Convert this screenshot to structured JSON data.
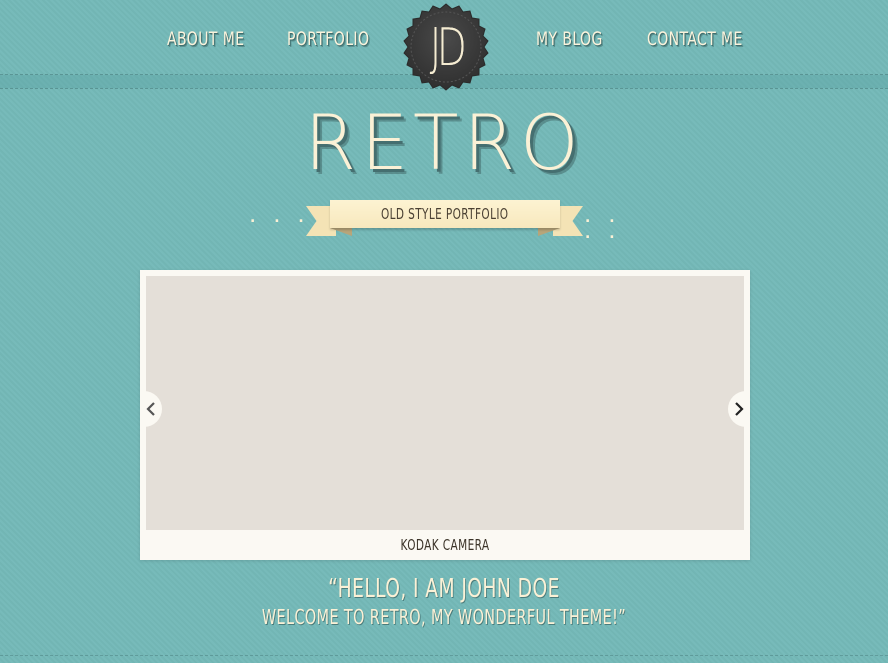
{
  "nav": {
    "items": [
      {
        "label": "About Me"
      },
      {
        "label": "Portfolio"
      },
      {
        "label": "My Blog"
      },
      {
        "label": "Contact Me"
      }
    ]
  },
  "logo": {
    "text": "JD"
  },
  "hero": {
    "title": "RETRO",
    "ribbon_text": "Old Style Portfolio",
    "ribbon_dots": ". . . ."
  },
  "slider": {
    "caption": "Kodak Camera",
    "prev_icon": "chevron-left-icon",
    "next_icon": "chevron-right-icon"
  },
  "intro": {
    "line1": "“Hello, I am John Doe",
    "line2": "Welcome to Retro, my wonderful theme!”"
  },
  "colors": {
    "background": "#74b9b8",
    "cream": "#fbf1d6",
    "badge": "#3d3d3d",
    "ribbon": "#f7e8bd",
    "slide_placeholder": "#e4dfd8"
  }
}
